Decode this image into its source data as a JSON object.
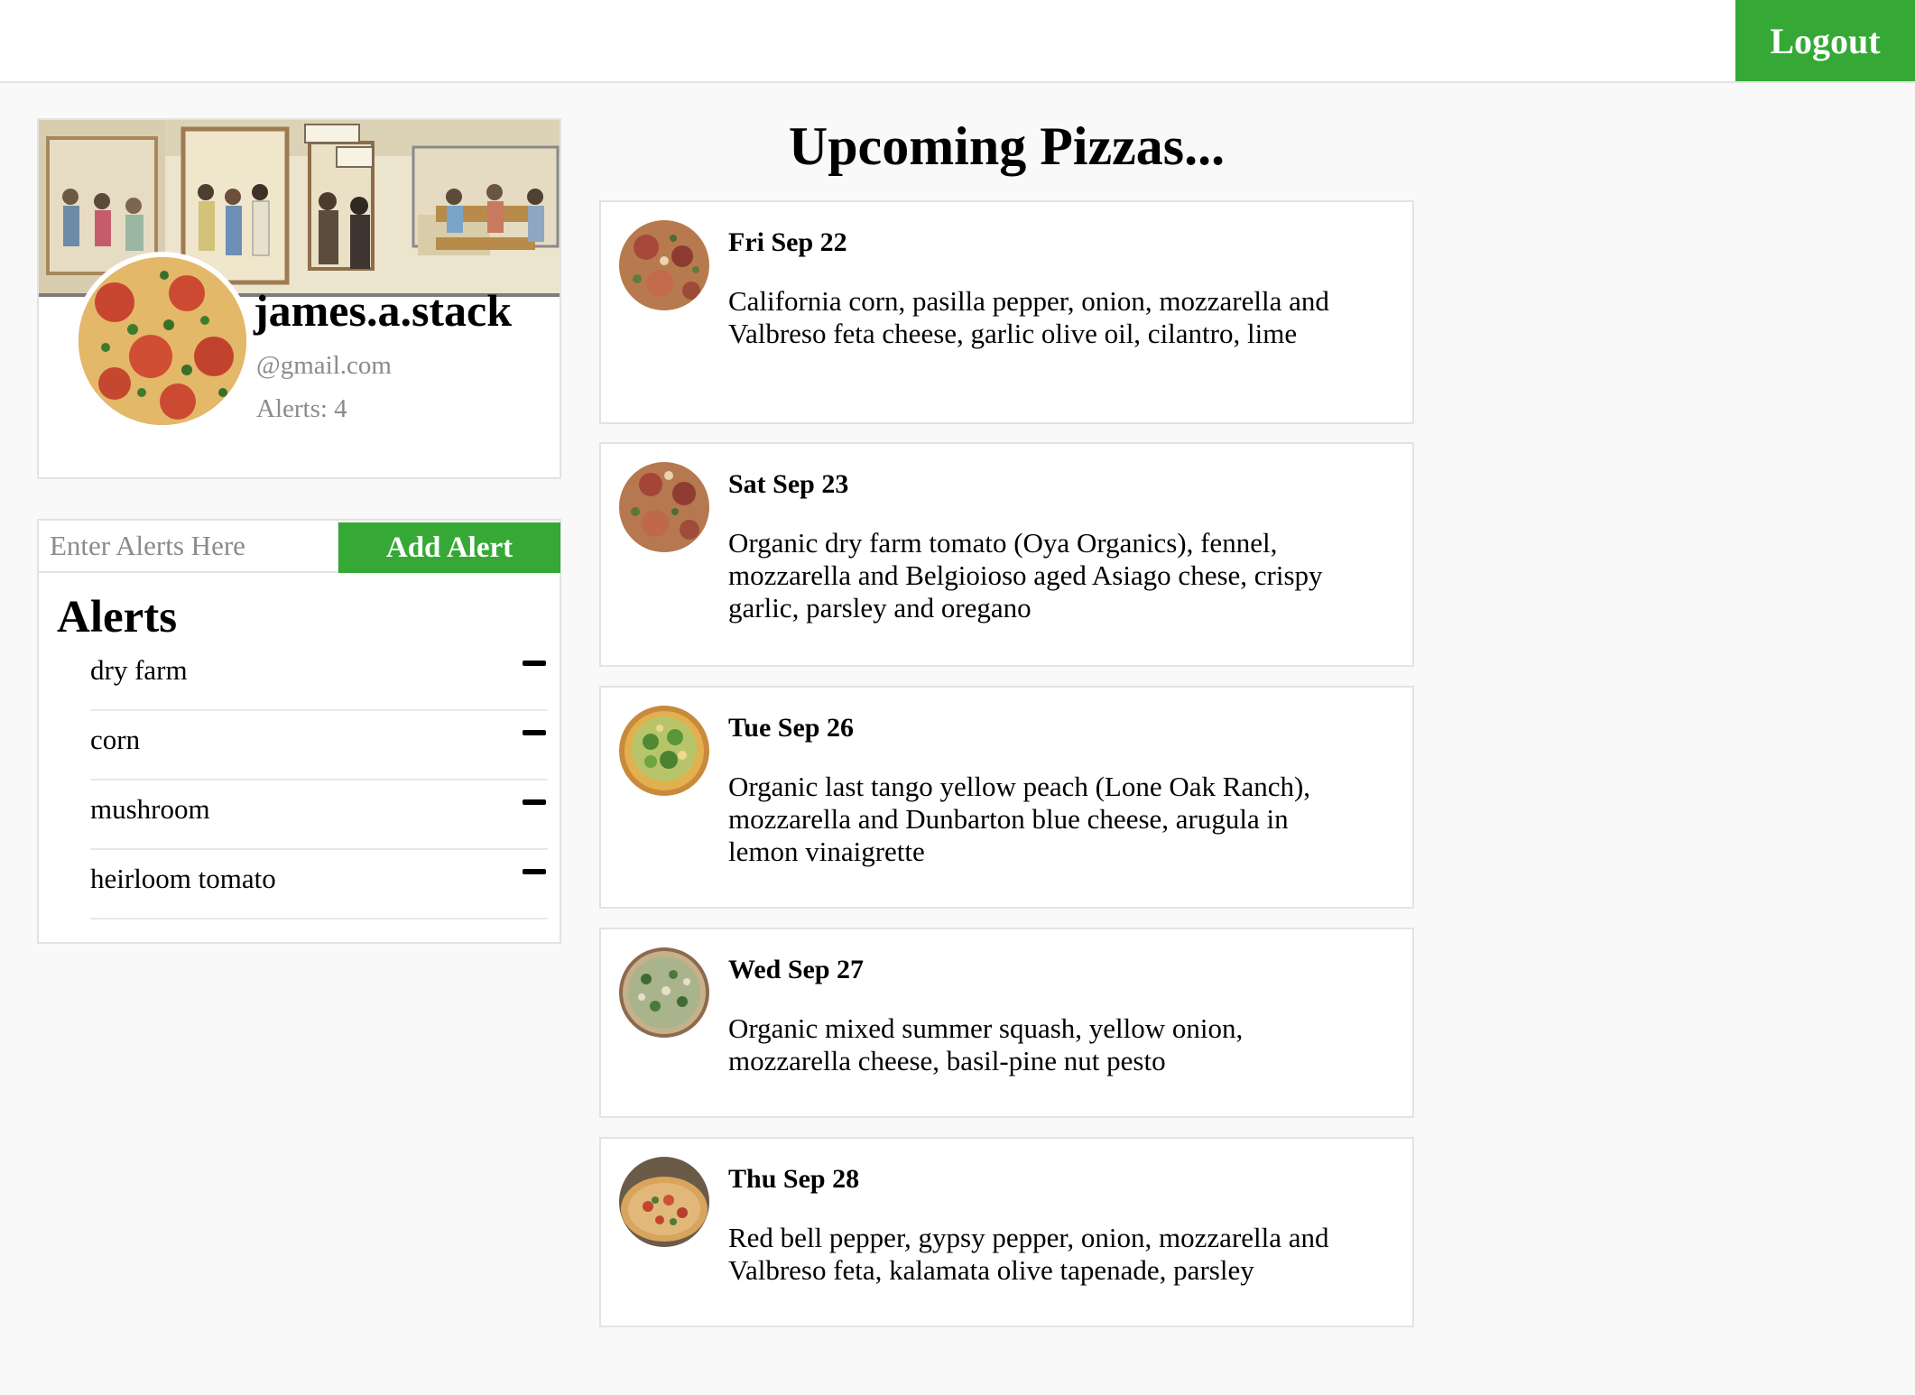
{
  "header": {
    "logout_label": "Logout"
  },
  "profile": {
    "username": "james.a.stack",
    "email": "@gmail.com",
    "alerts_count": "Alerts: 4"
  },
  "alerts": {
    "input_placeholder": "Enter Alerts Here",
    "add_button_label": "Add Alert",
    "title": "Alerts",
    "items": [
      {
        "label": "dry farm"
      },
      {
        "label": "corn"
      },
      {
        "label": "mushroom"
      },
      {
        "label": "heirloom tomato"
      }
    ]
  },
  "pizzas": {
    "title": "Upcoming Pizzas...",
    "items": [
      {
        "date": "Fri Sep 22",
        "description": "California corn, pasilla pepper, onion, mozzarella and Valbreso feta cheese, garlic olive oil, cilantro, lime"
      },
      {
        "date": "Sat Sep 23",
        "description": "Organic dry farm tomato (Oya Organics), fennel, mozzarella and Belgioioso aged Asiago chese, crispy garlic, parsley and oregano"
      },
      {
        "date": "Tue Sep 26",
        "description": "Organic last tango yellow peach (Lone Oak Ranch), mozzarella and Dunbarton blue cheese, arugula in lemon vinaigrette"
      },
      {
        "date": "Wed Sep 27",
        "description": "Organic mixed summer squash, yellow onion, mozzarella cheese, basil-pine nut pesto"
      },
      {
        "date": "Thu Sep 28",
        "description": "Red bell pepper, gypsy pepper, onion, mozzarella and Valbreso feta, kalamata olive tapenade, parsley"
      }
    ]
  },
  "colors": {
    "accent_green": "#35a835",
    "muted_text": "#8b8b8b",
    "border": "#e3e3e3",
    "background": "#f9f9f9"
  }
}
